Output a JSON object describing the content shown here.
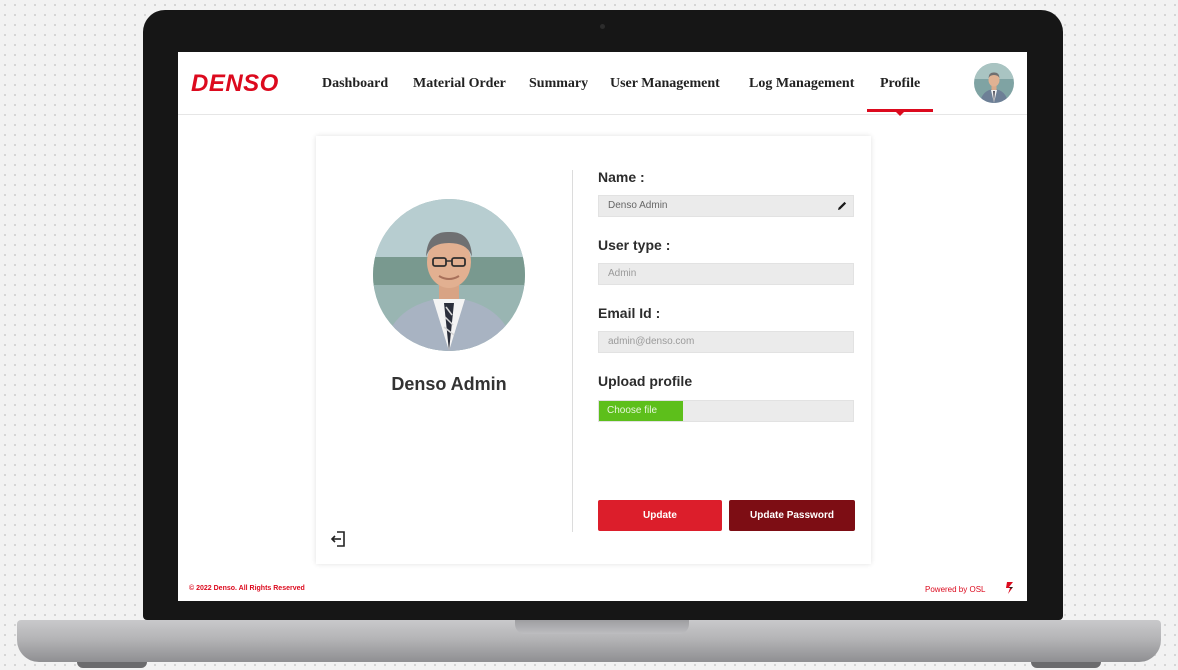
{
  "app": {
    "logo": "DENSO",
    "brand_color": "#dc0a1e"
  },
  "nav": {
    "items": [
      {
        "label": "Dashboard",
        "active": false
      },
      {
        "label": "Material Order",
        "active": false
      },
      {
        "label": "Summary",
        "active": false
      },
      {
        "label": "User Management",
        "active": false
      },
      {
        "label": "Log Management",
        "active": false
      },
      {
        "label": "Profile",
        "active": true
      }
    ],
    "avatar_icon": "user-avatar-icon"
  },
  "profile": {
    "display_name": "Denso Admin",
    "name_label": "Name :",
    "name_value": "Denso Admin",
    "user_type_label": "User type :",
    "user_type_value": "Admin",
    "email_label": "Email Id :",
    "email_value": "admin@denso.com",
    "upload_label": "Upload profile",
    "choose_file_label": "Choose file",
    "update_label": "Update",
    "update_password_label": "Update Password",
    "edit_icon": "pencil-icon",
    "logout_icon": "logout-icon"
  },
  "footer": {
    "copyright": "© 2022 Denso. All Rights Reserved",
    "powered_by": "Powered by OSL"
  },
  "colors": {
    "update_button": "#dc1e2b",
    "update_password_button": "#7d0d14",
    "choose_file_button": "#5dbf1b"
  }
}
